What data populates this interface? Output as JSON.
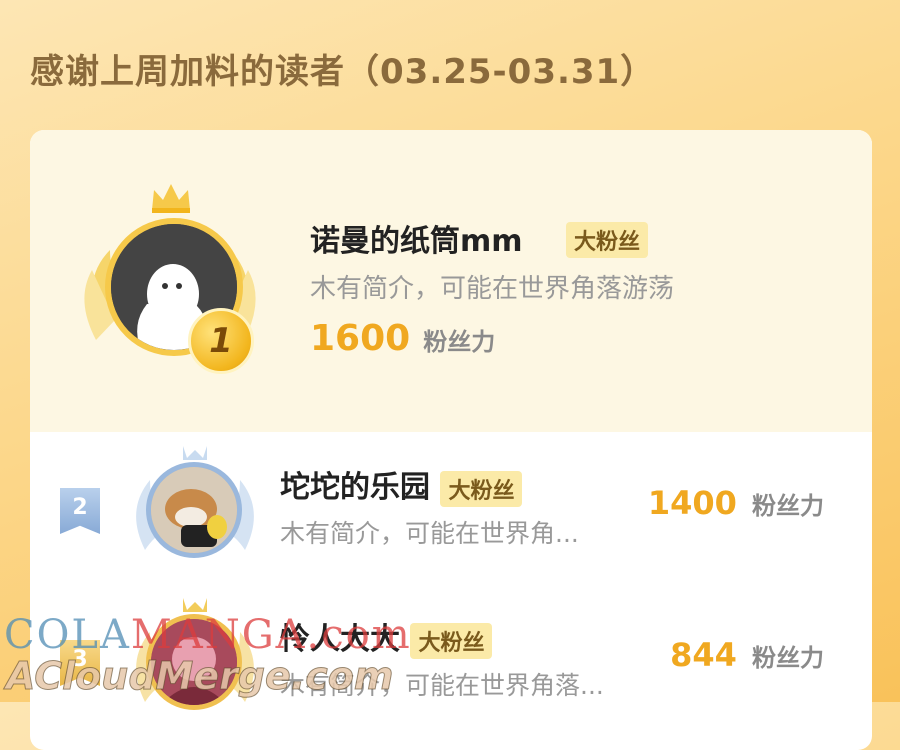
{
  "header": {
    "title": "感谢上周加料的读者（03.25-03.31）"
  },
  "ranking": [
    {
      "rank": "1",
      "name": "诺曼的纸筒mm",
      "badge": "大粉丝",
      "intro": "木有简介，可能在世界角落游荡",
      "score": "1600",
      "score_label": "粉丝力"
    },
    {
      "rank": "2",
      "name": "坨坨的乐园",
      "badge": "大粉丝",
      "intro": "木有简介，可能在世界角...",
      "score": "1400",
      "score_label": "粉丝力"
    },
    {
      "rank": "3",
      "name": "怜人大大",
      "badge": "大粉丝",
      "intro": "木有简介，可能在世界角落...",
      "score": "844",
      "score_label": "粉丝力"
    }
  ],
  "watermark": {
    "line1_blue": "COLA",
    "line1_red": "MANGA",
    "line1_end": ".com",
    "line2": "ACloudMerge.com"
  },
  "colors": {
    "accent": "#f0a820",
    "badge_bg": "#fbeaa8",
    "background": "#fcd78a"
  },
  "icons": {
    "crown": "crown-icon",
    "wings": "wings-icon",
    "medal": "medal-icon"
  }
}
